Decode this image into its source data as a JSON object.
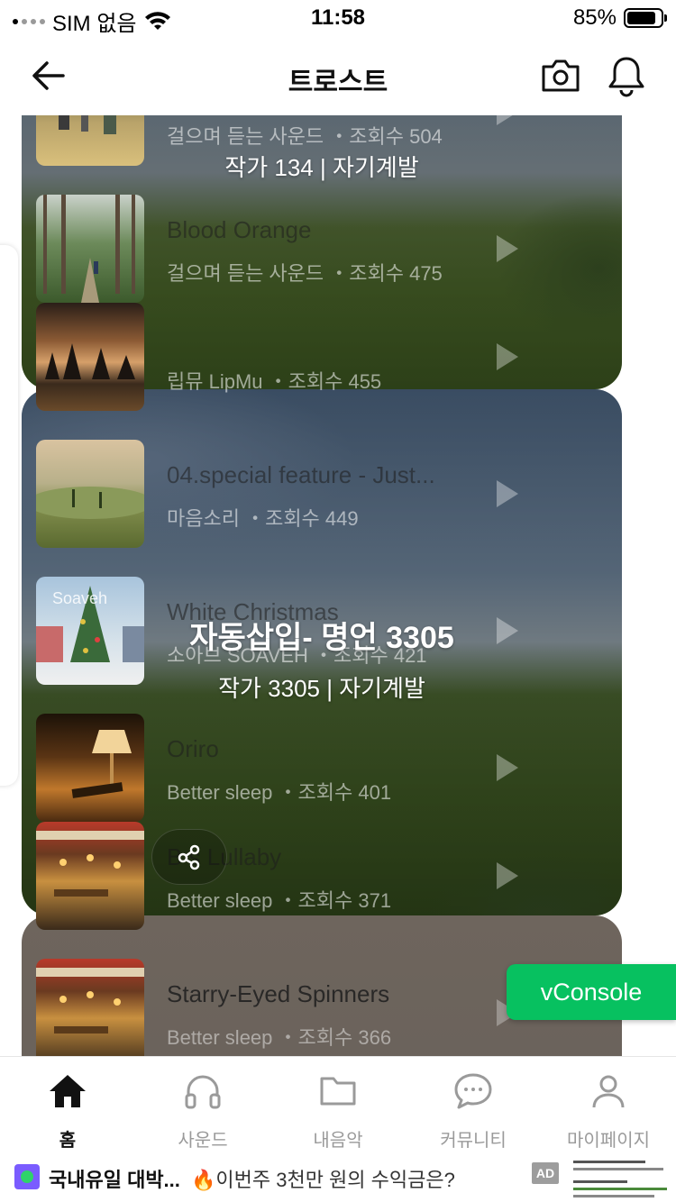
{
  "status_bar": {
    "carrier": "SIM 없음",
    "time": "11:58",
    "battery": "85%",
    "battery_level": 0.85
  },
  "header": {
    "title": "트로스트"
  },
  "cards": [
    {
      "overlay_title": "",
      "overlay_sub": "작가 134 | 자기계발",
      "tracks": [
        {
          "title": "",
          "meta": "걸으며 듣는 사운드 ・조회수 504"
        },
        {
          "title": "Blood Orange",
          "meta": "걸으며 듣는 사운드 ・조회수 475"
        },
        {
          "title": "",
          "meta": "립뮤 LipMu ・조회수 455"
        }
      ]
    },
    {
      "overlay_title": "자동삽입- 명언 3305",
      "overlay_sub": "작가 3305 | 자기계발",
      "tracks": [
        {
          "title": "04.special feature - Just...",
          "meta": "마음소리 ・조회수 449"
        },
        {
          "title": "White Christmas",
          "meta": "소아브 SOAVEH ・조회수 421",
          "thumb_text": "Soaveh"
        },
        {
          "title": "Oriro",
          "meta": "Better sleep ・조회수 401"
        },
        {
          "title": "B  s Lullaby",
          "meta": "Better sleep ・조회수 371"
        }
      ]
    },
    {
      "tracks": [
        {
          "title": "Starry-Eyed Spinners",
          "meta": "Better sleep ・조회수 366"
        }
      ]
    }
  ],
  "vconsole": {
    "label": "vConsole"
  },
  "tabbar": {
    "items": [
      {
        "label": "홈",
        "icon": "home-icon",
        "active": true
      },
      {
        "label": "사운드",
        "icon": "headphones-icon",
        "active": false
      },
      {
        "label": "내음악",
        "icon": "folder-icon",
        "active": false
      },
      {
        "label": "커뮤니티",
        "icon": "chat-icon",
        "active": false
      },
      {
        "label": "마이페이지",
        "icon": "person-icon",
        "active": false
      }
    ]
  },
  "ad": {
    "text1": "국내유일 대박...",
    "text2": "🔥이번주 3천만 원의 수익금은?",
    "badge": "AD"
  },
  "colors": {
    "vconsole": "#07c160",
    "accent_ad": "#7a5cff"
  }
}
